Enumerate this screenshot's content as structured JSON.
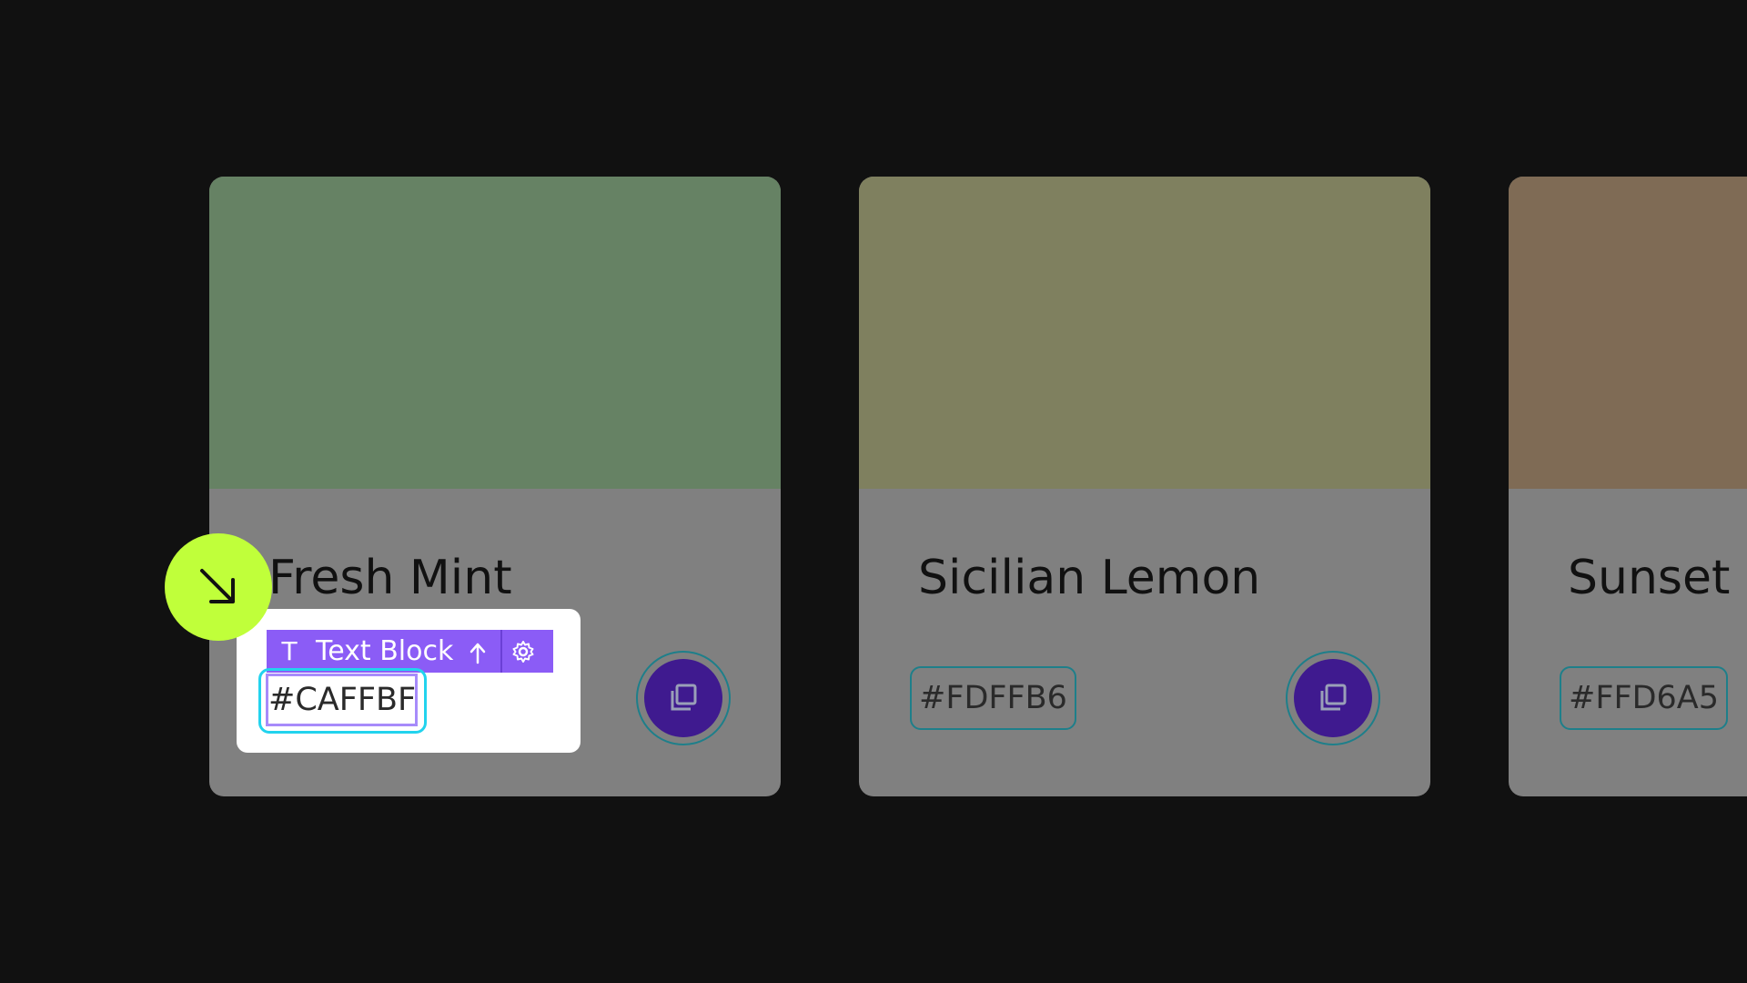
{
  "cards": [
    {
      "name": "Fresh Mint",
      "hex": "#CAFFBF",
      "swatch_color": "#668264"
    },
    {
      "name": "Sicilian Lemon",
      "hex": "#FDFFB6",
      "swatch_color": "#7f805f"
    },
    {
      "name": "Sunset",
      "hex": "#FFD6A5",
      "swatch_color": "#7f6b55"
    }
  ],
  "editor": {
    "toolbar_icon": "T",
    "toolbar_label": "Text Block",
    "selected_text": "#CAFFBF"
  },
  "colors": {
    "background": "#111111",
    "card_body": "#808080",
    "copy_button": "#3f1a8f",
    "toolbar": "#8b5cf6",
    "selection_outer": "#22d3ee",
    "selection_inner": "#a78bfa",
    "cursor_badge": "#c0ff3a"
  },
  "icons": {
    "copy": "copy-icon",
    "cursor": "arrow-down-right-icon",
    "toolbar_move": "arrow-up-icon",
    "toolbar_settings": "gear-icon"
  }
}
